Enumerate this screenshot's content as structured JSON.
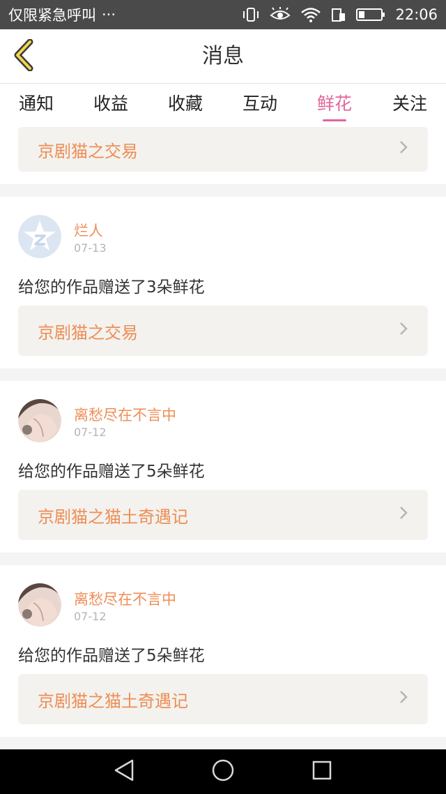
{
  "status_bar": {
    "carrier_text": "仅限紧急呼叫",
    "more": "···",
    "time": "22:06"
  },
  "header": {
    "title": "消息",
    "back_icon": "chevron-left-icon"
  },
  "tabs": [
    {
      "label": "通知",
      "active": false
    },
    {
      "label": "收益",
      "active": false
    },
    {
      "label": "收藏",
      "active": false
    },
    {
      "label": "互动",
      "active": false
    },
    {
      "label": "鲜花",
      "active": true
    },
    {
      "label": "关注",
      "active": false
    }
  ],
  "colors": {
    "accent_orange": "#ee8d55",
    "active_tab": "#e0679a",
    "link_bg": "#f3f2ee",
    "divider": "#f4f4f4"
  },
  "messages": [
    {
      "work_title": "京剧猫之交易"
    },
    {
      "user": "烂人",
      "date": "07-13",
      "text": "给您的作品赠送了3朵鲜花",
      "work_title": "京剧猫之交易",
      "avatar": "default-star-avatar"
    },
    {
      "user": "离愁尽在不言中",
      "date": "07-12",
      "text": "给您的作品赠送了5朵鲜花",
      "work_title": "京剧猫之猫土奇遇记",
      "avatar": "photo-avatar"
    },
    {
      "user": "离愁尽在不言中",
      "date": "07-12",
      "text": "给您的作品赠送了5朵鲜花",
      "work_title": "京剧猫之猫土奇遇记",
      "avatar": "photo-avatar"
    }
  ],
  "nav_bar": {
    "back": "triangle-back-icon",
    "home": "circle-home-icon",
    "recents": "square-recents-icon"
  }
}
